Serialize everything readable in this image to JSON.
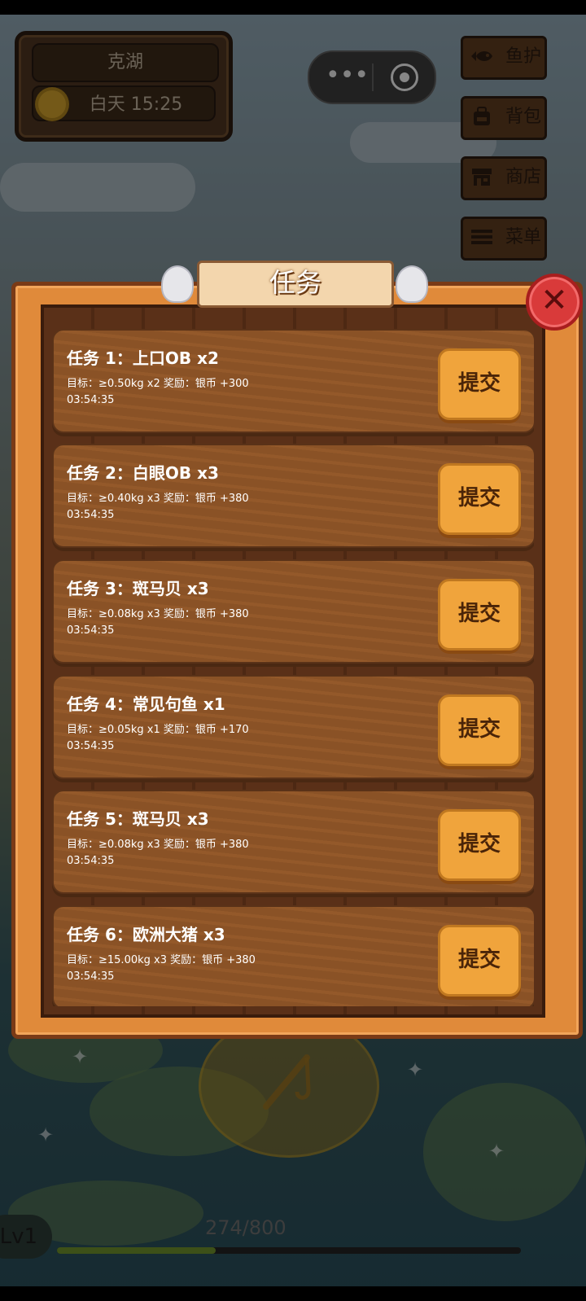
{
  "location": {
    "name": "克湖",
    "time_label": "白天 15:25",
    "weather_icon": "sun-icon"
  },
  "side_menu": [
    {
      "label": "鱼护",
      "icon": "fish-icon"
    },
    {
      "label": "背包",
      "icon": "backpack-icon"
    },
    {
      "label": "商店",
      "icon": "shop-icon"
    },
    {
      "label": "菜单",
      "icon": "menu-icon"
    }
  ],
  "mini_program_capsule": {
    "more_icon": "more-dots-icon",
    "close_icon": "target-circle-icon"
  },
  "dialog": {
    "title": "任务",
    "close_icon": "close-x-icon"
  },
  "tasks": [
    {
      "title": "任务 1：上口OB x2",
      "detail": "目标：≥0.50kg x2  奖励：银币 +300",
      "timer": "03:54:35",
      "button": "提交"
    },
    {
      "title": "任务 2：白眼OB x3",
      "detail": "目标：≥0.40kg x3  奖励：银币 +380",
      "timer": "03:54:35",
      "button": "提交"
    },
    {
      "title": "任务 3：斑马贝 x3",
      "detail": "目标：≥0.08kg x3  奖励：银币 +380",
      "timer": "03:54:35",
      "button": "提交"
    },
    {
      "title": "任务 4：常见句鱼 x1",
      "detail": "目标：≥0.05kg x1  奖励：银币 +170",
      "timer": "03:54:35",
      "button": "提交"
    },
    {
      "title": "任务 5：斑马贝 x3",
      "detail": "目标：≥0.08kg x3  奖励：银币 +380",
      "timer": "03:54:35",
      "button": "提交"
    },
    {
      "title": "任务 6：欧洲大猪 x3",
      "detail": "目标：≥15.00kg x3  奖励：银币 +380",
      "timer": "03:54:35",
      "button": "提交"
    }
  ],
  "hud": {
    "level": "Lv1",
    "xp_text": "274/800",
    "xp_progress": 0.3425,
    "cast_icon": "fishing-rod-icon"
  },
  "colors": {
    "panel_orange": "#e08a3a",
    "button_orange": "#f0a43c",
    "close_red": "#d93a3a",
    "wood_brown": "#8a5226"
  }
}
